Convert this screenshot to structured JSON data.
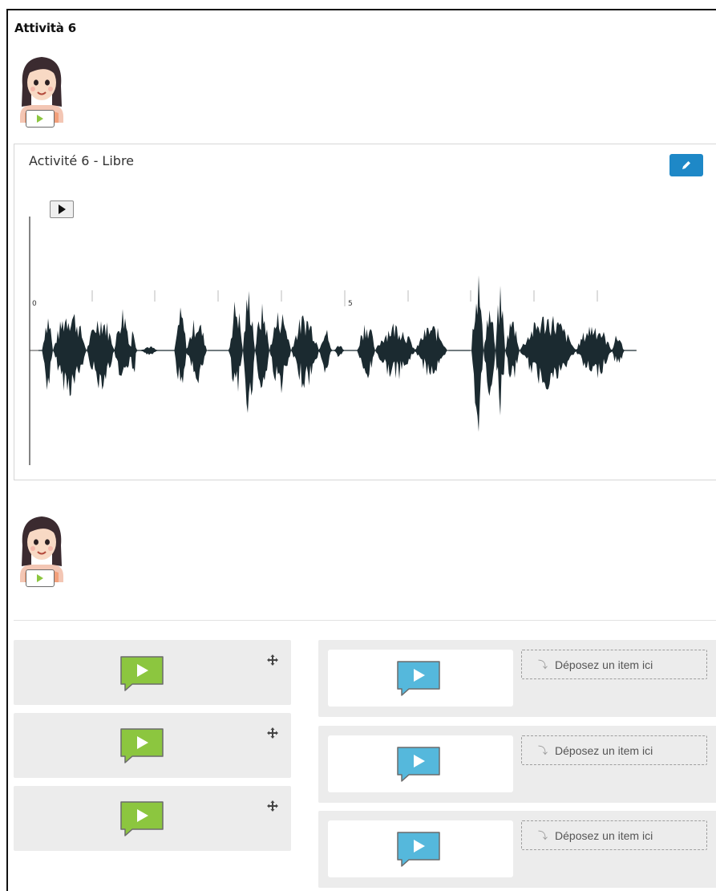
{
  "page": {
    "title": "Attività 6"
  },
  "audio_panel": {
    "title": "Activité 6 - Libre",
    "timeline_labels": [
      "0",
      "5"
    ],
    "colors": {
      "waveform": "#1b2a30",
      "edit_button": "#1e88c7"
    },
    "icons": {
      "edit": "pencil-icon",
      "play": "play-icon"
    }
  },
  "drag_items": [
    {
      "icon": "speech-bubble-play-icon",
      "color": "#8cc63f"
    },
    {
      "icon": "speech-bubble-play-icon",
      "color": "#8cc63f"
    },
    {
      "icon": "speech-bubble-play-icon",
      "color": "#8cc63f"
    }
  ],
  "drop_rows": [
    {
      "icon": "speech-bubble-play-icon",
      "color": "#55b8dc",
      "placeholder": "Déposez un item ici"
    },
    {
      "icon": "speech-bubble-play-icon",
      "color": "#55b8dc",
      "placeholder": "Déposez un item ici"
    },
    {
      "icon": "speech-bubble-play-icon",
      "color": "#55b8dc",
      "placeholder": "Déposez un item ici"
    }
  ]
}
